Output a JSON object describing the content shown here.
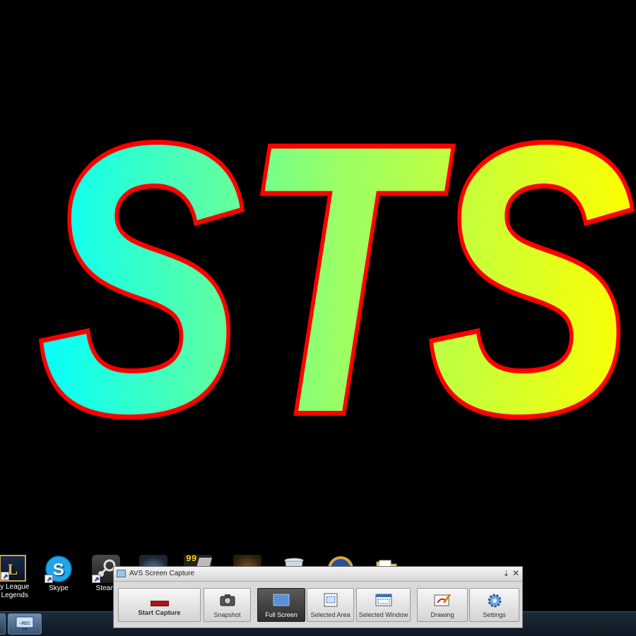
{
  "logo": {
    "text": "STS",
    "colors": {
      "start": "#00ffff",
      "mid": "#99ff66",
      "end": "#ffff00",
      "outline": "#ff0000"
    }
  },
  "desktop": {
    "icons": [
      {
        "name": "league-of-legends",
        "label_line1": "ay League",
        "label_line2": "f Legends"
      },
      {
        "name": "skype",
        "label": "Skype"
      },
      {
        "name": "steam",
        "label": "Steam"
      },
      {
        "name": "game-4"
      },
      {
        "name": "game-99",
        "badge": "99"
      },
      {
        "name": "game-6"
      },
      {
        "name": "recycle-bin"
      },
      {
        "name": "world-of-warcraft"
      },
      {
        "name": "folder"
      }
    ]
  },
  "avs": {
    "title": "AVS Screen Capture",
    "buttons": [
      {
        "id": "start-capture",
        "label": "Start Capture",
        "icon": "record-icon"
      },
      {
        "id": "snapshot",
        "label": "Snapshot",
        "icon": "camera-icon"
      },
      {
        "id": "full-screen",
        "label": "Full Screen",
        "icon": "full-screen-icon",
        "active": true
      },
      {
        "id": "selected-area",
        "label": "Selected Area",
        "icon": "selected-area-icon"
      },
      {
        "id": "selected-window",
        "label": "Selected Window",
        "icon": "selected-window-icon"
      },
      {
        "id": "drawing",
        "label": "Drawing",
        "icon": "drawing-icon"
      },
      {
        "id": "settings",
        "label": "Settings",
        "icon": "gear-icon"
      }
    ]
  },
  "taskbar": {
    "items": [
      "start-orb",
      "avs-screen-capture-task"
    ]
  }
}
